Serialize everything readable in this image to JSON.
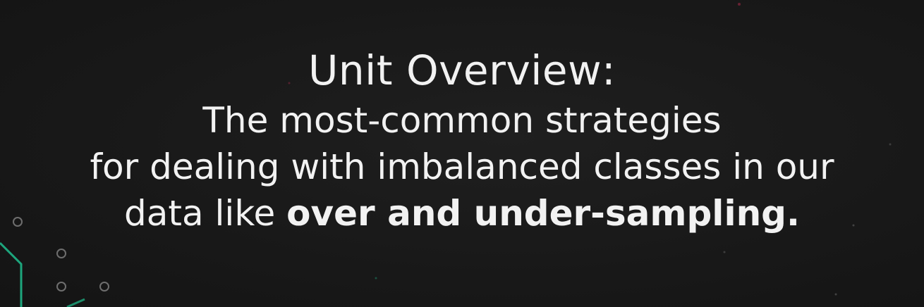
{
  "slide": {
    "title": "Unit Overview",
    "title_suffix": ":",
    "line1": "The most-common strategies",
    "line2": "for dealing with imbalanced classes in our",
    "line3_plain": "data like ",
    "line3_bold": "over and under-sampling."
  },
  "colors": {
    "background": "#1a1a1a",
    "text": "#f2f2f2",
    "accent_circuit": "#1fbf8f",
    "node_outline": "#7a7a7a"
  }
}
